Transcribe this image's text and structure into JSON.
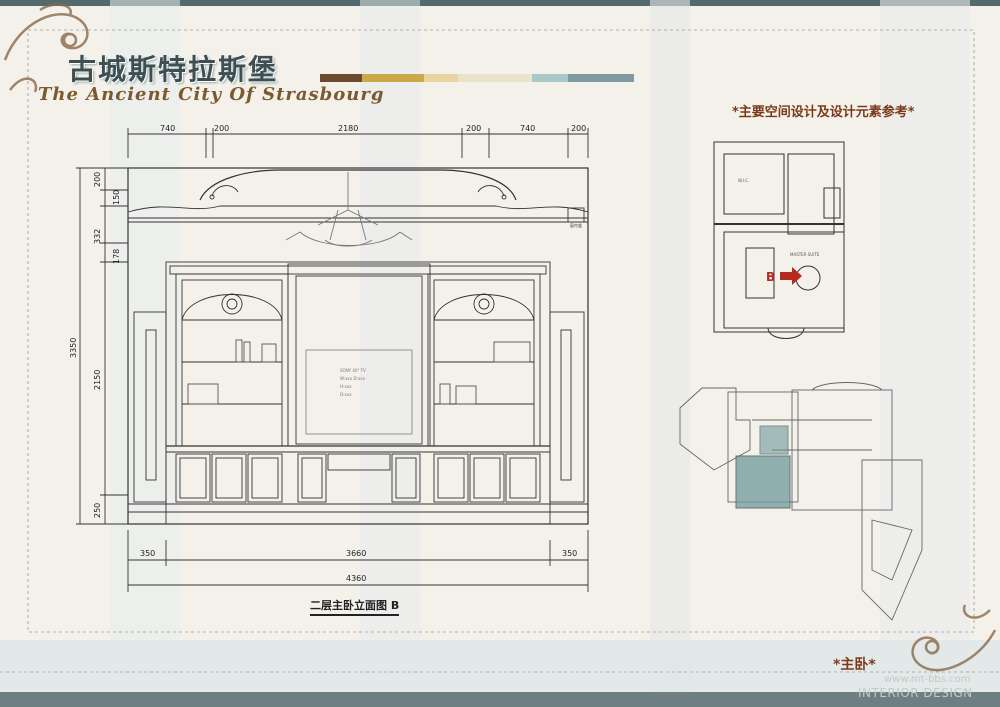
{
  "header": {
    "title_cn": "古城斯特拉斯堡",
    "title_en": "The Ancient City Of Strasbourg",
    "section_title": "*主要空间设计及设计元素参考*"
  },
  "palette": [
    "#6b4a30",
    "#c9a94a",
    "#e6d5a0",
    "#eae3cc",
    "#a9c9c9",
    "#7f9aa0"
  ],
  "drawing": {
    "caption": "二层主卧立面图 B",
    "dims_top": [
      "740",
      "200",
      "2180",
      "200",
      "740",
      "200"
    ],
    "dims_left": [
      "200",
      "150",
      "332",
      "178",
      "2150",
      "250"
    ],
    "dim_total_height": "3350",
    "dims_bottom": [
      "350",
      "3660",
      "350"
    ],
    "dim_total_width": "4360",
    "tv_note": [
      "SONY 40\" TV",
      "W:xxx D:xxx",
      "H:xxx",
      "D:xxx"
    ],
    "small_tag": "窗帘盒"
  },
  "plan": {
    "wic_label": "W.I.C.",
    "suite_label": "MASTER SUITE",
    "marker_letter": "B"
  },
  "footer": {
    "room_label": "*主卧*",
    "watermark_site": "www.mt-bbs.com",
    "watermark_text": "INTERIOR DESIGN"
  }
}
